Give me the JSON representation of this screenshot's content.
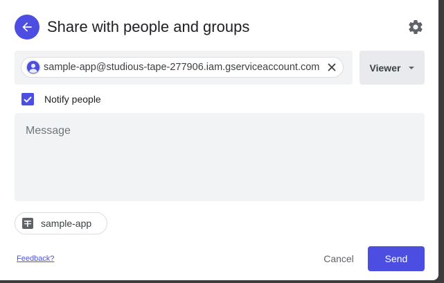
{
  "dialog": {
    "title": "Share with people and groups",
    "back_icon": "arrow-left-icon",
    "settings_icon": "gear-icon"
  },
  "recipients": {
    "chips": [
      {
        "email": "sample-app@studious-tape-277906.iam.gserviceaccount.com",
        "avatar_icon": "person-avatar-icon",
        "remove_icon": "close-icon"
      }
    ]
  },
  "role": {
    "selected": "Viewer",
    "icon": "caret-down-icon"
  },
  "notify": {
    "label": "Notify people",
    "checked": true
  },
  "message": {
    "placeholder": "Message",
    "value": ""
  },
  "file": {
    "name": "sample-app",
    "icon": "sheets-file-icon"
  },
  "footer": {
    "feedback_label": "Feedback?",
    "cancel_label": "Cancel",
    "send_label": "Send"
  },
  "colors": {
    "accent": "#4b4ee0",
    "chip_bg": "#f1f3f4",
    "role_bg": "#e8eaed",
    "backdrop": "#3c3c3c"
  }
}
